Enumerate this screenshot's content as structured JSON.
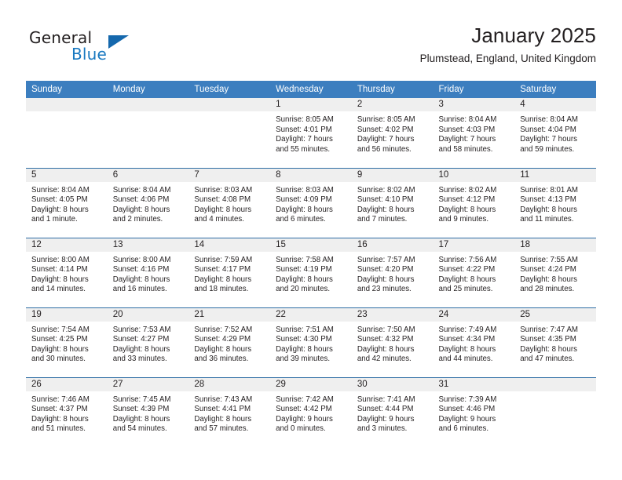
{
  "brand": {
    "name_top": "General",
    "name_bottom": "Blue",
    "accent_color": "#1878c0",
    "triangle_color": "#1568ad"
  },
  "header": {
    "title": "January 2025",
    "location": "Plumstead, England, United Kingdom"
  },
  "theme": {
    "header_row_bg": "#3c7ebf",
    "row_divider": "#2e6da4",
    "daynum_band_bg": "#efefef",
    "text_color": "#231f20"
  },
  "weekdays": [
    "Sunday",
    "Monday",
    "Tuesday",
    "Wednesday",
    "Thursday",
    "Friday",
    "Saturday"
  ],
  "weeks": [
    [
      {
        "day": "",
        "sunrise": "",
        "sunset": "",
        "daylight1": "",
        "daylight2": ""
      },
      {
        "day": "",
        "sunrise": "",
        "sunset": "",
        "daylight1": "",
        "daylight2": ""
      },
      {
        "day": "",
        "sunrise": "",
        "sunset": "",
        "daylight1": "",
        "daylight2": ""
      },
      {
        "day": "1",
        "sunrise": "Sunrise: 8:05 AM",
        "sunset": "Sunset: 4:01 PM",
        "daylight1": "Daylight: 7 hours",
        "daylight2": "and 55 minutes."
      },
      {
        "day": "2",
        "sunrise": "Sunrise: 8:05 AM",
        "sunset": "Sunset: 4:02 PM",
        "daylight1": "Daylight: 7 hours",
        "daylight2": "and 56 minutes."
      },
      {
        "day": "3",
        "sunrise": "Sunrise: 8:04 AM",
        "sunset": "Sunset: 4:03 PM",
        "daylight1": "Daylight: 7 hours",
        "daylight2": "and 58 minutes."
      },
      {
        "day": "4",
        "sunrise": "Sunrise: 8:04 AM",
        "sunset": "Sunset: 4:04 PM",
        "daylight1": "Daylight: 7 hours",
        "daylight2": "and 59 minutes."
      }
    ],
    [
      {
        "day": "5",
        "sunrise": "Sunrise: 8:04 AM",
        "sunset": "Sunset: 4:05 PM",
        "daylight1": "Daylight: 8 hours",
        "daylight2": "and 1 minute."
      },
      {
        "day": "6",
        "sunrise": "Sunrise: 8:04 AM",
        "sunset": "Sunset: 4:06 PM",
        "daylight1": "Daylight: 8 hours",
        "daylight2": "and 2 minutes."
      },
      {
        "day": "7",
        "sunrise": "Sunrise: 8:03 AM",
        "sunset": "Sunset: 4:08 PM",
        "daylight1": "Daylight: 8 hours",
        "daylight2": "and 4 minutes."
      },
      {
        "day": "8",
        "sunrise": "Sunrise: 8:03 AM",
        "sunset": "Sunset: 4:09 PM",
        "daylight1": "Daylight: 8 hours",
        "daylight2": "and 6 minutes."
      },
      {
        "day": "9",
        "sunrise": "Sunrise: 8:02 AM",
        "sunset": "Sunset: 4:10 PM",
        "daylight1": "Daylight: 8 hours",
        "daylight2": "and 7 minutes."
      },
      {
        "day": "10",
        "sunrise": "Sunrise: 8:02 AM",
        "sunset": "Sunset: 4:12 PM",
        "daylight1": "Daylight: 8 hours",
        "daylight2": "and 9 minutes."
      },
      {
        "day": "11",
        "sunrise": "Sunrise: 8:01 AM",
        "sunset": "Sunset: 4:13 PM",
        "daylight1": "Daylight: 8 hours",
        "daylight2": "and 11 minutes."
      }
    ],
    [
      {
        "day": "12",
        "sunrise": "Sunrise: 8:00 AM",
        "sunset": "Sunset: 4:14 PM",
        "daylight1": "Daylight: 8 hours",
        "daylight2": "and 14 minutes."
      },
      {
        "day": "13",
        "sunrise": "Sunrise: 8:00 AM",
        "sunset": "Sunset: 4:16 PM",
        "daylight1": "Daylight: 8 hours",
        "daylight2": "and 16 minutes."
      },
      {
        "day": "14",
        "sunrise": "Sunrise: 7:59 AM",
        "sunset": "Sunset: 4:17 PM",
        "daylight1": "Daylight: 8 hours",
        "daylight2": "and 18 minutes."
      },
      {
        "day": "15",
        "sunrise": "Sunrise: 7:58 AM",
        "sunset": "Sunset: 4:19 PM",
        "daylight1": "Daylight: 8 hours",
        "daylight2": "and 20 minutes."
      },
      {
        "day": "16",
        "sunrise": "Sunrise: 7:57 AM",
        "sunset": "Sunset: 4:20 PM",
        "daylight1": "Daylight: 8 hours",
        "daylight2": "and 23 minutes."
      },
      {
        "day": "17",
        "sunrise": "Sunrise: 7:56 AM",
        "sunset": "Sunset: 4:22 PM",
        "daylight1": "Daylight: 8 hours",
        "daylight2": "and 25 minutes."
      },
      {
        "day": "18",
        "sunrise": "Sunrise: 7:55 AM",
        "sunset": "Sunset: 4:24 PM",
        "daylight1": "Daylight: 8 hours",
        "daylight2": "and 28 minutes."
      }
    ],
    [
      {
        "day": "19",
        "sunrise": "Sunrise: 7:54 AM",
        "sunset": "Sunset: 4:25 PM",
        "daylight1": "Daylight: 8 hours",
        "daylight2": "and 30 minutes."
      },
      {
        "day": "20",
        "sunrise": "Sunrise: 7:53 AM",
        "sunset": "Sunset: 4:27 PM",
        "daylight1": "Daylight: 8 hours",
        "daylight2": "and 33 minutes."
      },
      {
        "day": "21",
        "sunrise": "Sunrise: 7:52 AM",
        "sunset": "Sunset: 4:29 PM",
        "daylight1": "Daylight: 8 hours",
        "daylight2": "and 36 minutes."
      },
      {
        "day": "22",
        "sunrise": "Sunrise: 7:51 AM",
        "sunset": "Sunset: 4:30 PM",
        "daylight1": "Daylight: 8 hours",
        "daylight2": "and 39 minutes."
      },
      {
        "day": "23",
        "sunrise": "Sunrise: 7:50 AM",
        "sunset": "Sunset: 4:32 PM",
        "daylight1": "Daylight: 8 hours",
        "daylight2": "and 42 minutes."
      },
      {
        "day": "24",
        "sunrise": "Sunrise: 7:49 AM",
        "sunset": "Sunset: 4:34 PM",
        "daylight1": "Daylight: 8 hours",
        "daylight2": "and 44 minutes."
      },
      {
        "day": "25",
        "sunrise": "Sunrise: 7:47 AM",
        "sunset": "Sunset: 4:35 PM",
        "daylight1": "Daylight: 8 hours",
        "daylight2": "and 47 minutes."
      }
    ],
    [
      {
        "day": "26",
        "sunrise": "Sunrise: 7:46 AM",
        "sunset": "Sunset: 4:37 PM",
        "daylight1": "Daylight: 8 hours",
        "daylight2": "and 51 minutes."
      },
      {
        "day": "27",
        "sunrise": "Sunrise: 7:45 AM",
        "sunset": "Sunset: 4:39 PM",
        "daylight1": "Daylight: 8 hours",
        "daylight2": "and 54 minutes."
      },
      {
        "day": "28",
        "sunrise": "Sunrise: 7:43 AM",
        "sunset": "Sunset: 4:41 PM",
        "daylight1": "Daylight: 8 hours",
        "daylight2": "and 57 minutes."
      },
      {
        "day": "29",
        "sunrise": "Sunrise: 7:42 AM",
        "sunset": "Sunset: 4:42 PM",
        "daylight1": "Daylight: 9 hours",
        "daylight2": "and 0 minutes."
      },
      {
        "day": "30",
        "sunrise": "Sunrise: 7:41 AM",
        "sunset": "Sunset: 4:44 PM",
        "daylight1": "Daylight: 9 hours",
        "daylight2": "and 3 minutes."
      },
      {
        "day": "31",
        "sunrise": "Sunrise: 7:39 AM",
        "sunset": "Sunset: 4:46 PM",
        "daylight1": "Daylight: 9 hours",
        "daylight2": "and 6 minutes."
      },
      {
        "day": "",
        "sunrise": "",
        "sunset": "",
        "daylight1": "",
        "daylight2": ""
      }
    ]
  ]
}
